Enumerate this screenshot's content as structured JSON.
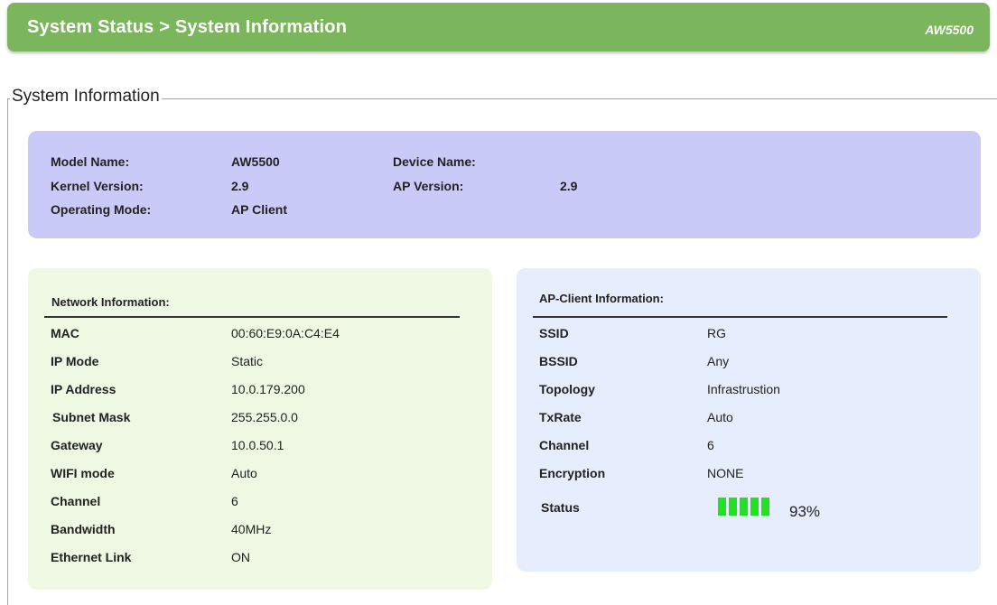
{
  "header": {
    "title": "System Status > System Information",
    "model": "AW5500",
    "color": "#7cb65c"
  },
  "section": {
    "legend": "System Information"
  },
  "summary": {
    "model_name_label": "Model Name:",
    "model_name_value": "AW5500",
    "device_name_label": "Device Name:",
    "device_name_value": "",
    "kernel_version_label": "Kernel Version:",
    "kernel_version_value": "2.9",
    "ap_version_label": "AP Version:",
    "ap_version_value": "2.9",
    "operating_mode_label": "Operating Mode:",
    "operating_mode_value": "AP Client",
    "color": "#c9caf7"
  },
  "network": {
    "title": "Network Information:",
    "rows": [
      {
        "label": "MAC",
        "value": "00:60:E9:0A:C4:E4"
      },
      {
        "label": "IP Mode",
        "value": "Static"
      },
      {
        "label": "IP Address",
        "value": "10.0.179.200"
      },
      {
        "label": "Subnet Mask",
        "value": "255.255.0.0"
      },
      {
        "label": "Gateway",
        "value": "10.0.50.1"
      },
      {
        "label": "WIFI mode",
        "value": "Auto"
      },
      {
        "label": "Channel",
        "value": "6"
      },
      {
        "label": "Bandwidth",
        "value": "40MHz"
      },
      {
        "label": "Ethernet Link",
        "value": "ON"
      }
    ],
    "color": "#eef8e2"
  },
  "ap_client": {
    "title": "AP-Client Information:",
    "rows": [
      {
        "label": "SSID",
        "value": "RG"
      },
      {
        "label": "BSSID",
        "value": "Any"
      },
      {
        "label": "Topology",
        "value": "Infrastrustion"
      },
      {
        "label": "TxRate",
        "value": "Auto"
      },
      {
        "label": "Channel",
        "value": "6"
      },
      {
        "label": "Encryption",
        "value": "NONE"
      }
    ],
    "status_label": "Status",
    "signal_percent": "93%",
    "signal_bars": 5,
    "signal_color": "#22e022",
    "color": "#e6edfd"
  }
}
